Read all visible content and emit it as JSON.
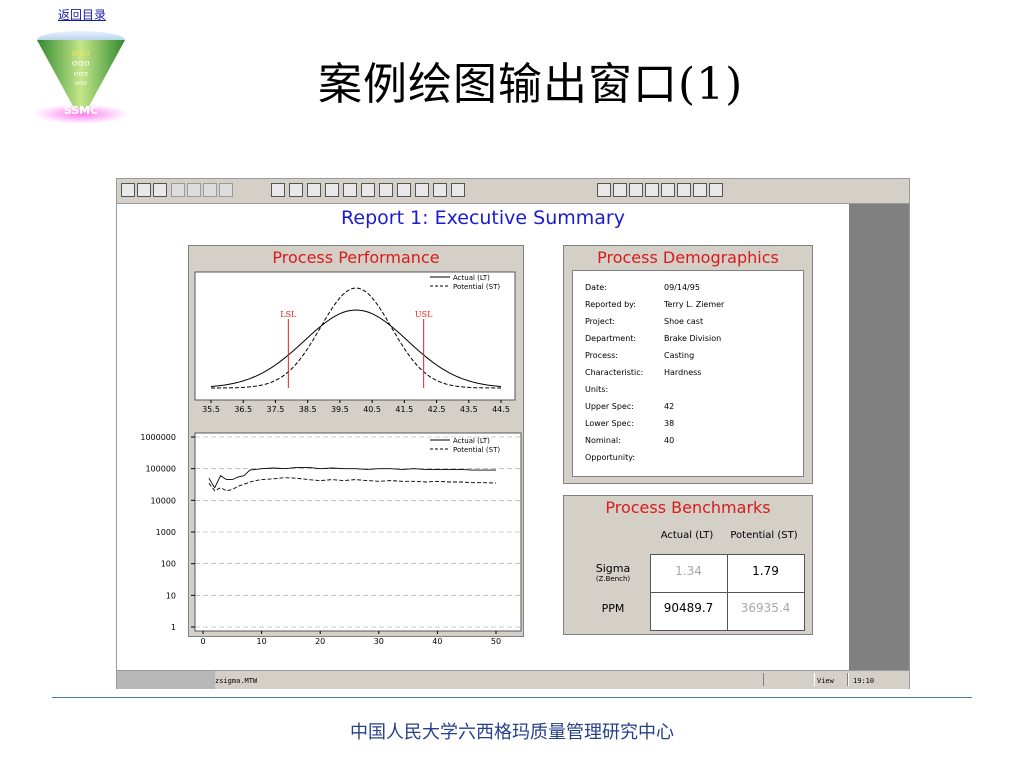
{
  "nav": {
    "back_label": "返回目录"
  },
  "logo": {
    "symbol_rows": [
      "σσσ",
      "σσσ",
      "σσσ",
      "σσσ"
    ],
    "text": "SSMC"
  },
  "slide": {
    "title": "案例绘图输出窗口(1)"
  },
  "footer": {
    "text": "中国人民大学六西格玛质量管理研究中心"
  },
  "window": {
    "status": {
      "file": "zsigma.MTW",
      "mode": "View",
      "clock": "19:10"
    },
    "toolbar_icons": [
      "open-icon",
      "save-icon",
      "print-icon",
      "cut-icon",
      "copy-icon",
      "paste-icon",
      "undo-icon",
      "session-window-icon",
      "data-window-icon",
      "info-icon",
      "history-icon",
      "graph-icon",
      "brush-icon",
      "edit-graph-icon",
      "pen-icon",
      "cancel-icon",
      "help-icon",
      "project-manager-icon",
      "graph-folder-icon",
      "show-graphs-icon",
      "tile-icon",
      "info2-icon",
      "report-pad-icon",
      "related-docs-icon",
      "new-graph-icon",
      "layout-icon"
    ]
  },
  "report": {
    "title": "Report 1: Executive Summary",
    "performance": {
      "title": "Process Performance"
    },
    "demographics": {
      "title": "Process Demographics",
      "rows": [
        {
          "label": "Date:",
          "value": "09/14/95"
        },
        {
          "label": "Reported by:",
          "value": "Terry L. Ziemer"
        },
        {
          "label": "Project:",
          "value": "Shoe cast"
        },
        {
          "label": "Department:",
          "value": "Brake Division"
        },
        {
          "label": "Process:",
          "value": "Casting"
        },
        {
          "label": "Characteristic:",
          "value": "Hardness"
        },
        {
          "label": "Units:",
          "value": ""
        },
        {
          "label": "Upper Spec:",
          "value": "42"
        },
        {
          "label": "Lower Spec:",
          "value": "38"
        },
        {
          "label": "Nominal:",
          "value": "40"
        },
        {
          "label": "Opportunity:",
          "value": ""
        }
      ]
    },
    "benchmarks": {
      "title": "Process Benchmarks",
      "col_actual": "Actual (LT)",
      "col_potential": "Potential (ST)",
      "sigma_label": "Sigma",
      "sigma_sub": "(Z.Bench)",
      "ppm_label": "PPM",
      "sigma_actual": "1.34",
      "sigma_potential": "1.79",
      "ppm_actual": "90489.7",
      "ppm_potential": "36935.4"
    }
  },
  "chart_data": [
    {
      "type": "line",
      "xlim": [
        35.5,
        44.5
      ],
      "x_ticks": [
        "35.5",
        "36.5",
        "37.5",
        "38.5",
        "39.5",
        "40.5",
        "41.5",
        "42.5",
        "43.5",
        "44.5"
      ],
      "series": [
        {
          "name": "Actual (LT)",
          "style": "solid",
          "mean": 40,
          "sd": 1.6,
          "peak": 0.78
        },
        {
          "name": "Potential (ST)",
          "style": "dashed",
          "mean": 40,
          "sd": 1.1,
          "peak": 1.0
        }
      ],
      "spec_lines": [
        {
          "label": "LSL",
          "x": 37.9,
          "color": "#e02020"
        },
        {
          "label": "USL",
          "x": 42.1,
          "color": "#e02020"
        }
      ],
      "legend": "top-right"
    },
    {
      "type": "line",
      "y_scale": "log",
      "ylim": [
        1,
        1000000
      ],
      "y_ticks": [
        "1000000",
        "100000",
        "10000",
        "1000",
        "100",
        "10",
        "1"
      ],
      "xlim": [
        0,
        50
      ],
      "x_ticks": [
        "0",
        "10",
        "20",
        "30",
        "40",
        "50"
      ],
      "grid": true,
      "series": [
        {
          "name": "Actual (LT)",
          "style": "solid",
          "x": [
            1,
            2,
            3,
            4,
            5,
            6,
            7,
            8,
            9,
            10,
            12,
            14,
            16,
            18,
            20,
            22,
            24,
            26,
            28,
            30,
            32,
            34,
            36,
            38,
            40,
            42,
            44,
            46,
            48,
            50
          ],
          "values": [
            50000,
            25000,
            60000,
            45000,
            45000,
            55000,
            60000,
            90000,
            95000,
            100000,
            105000,
            100000,
            110000,
            110000,
            100000,
            105000,
            100000,
            100000,
            95000,
            100000,
            100000,
            95000,
            100000,
            95000,
            95000,
            95000,
            95000,
            90000,
            90000,
            90000
          ]
        },
        {
          "name": "Potential (ST)",
          "style": "dashed",
          "x": [
            1,
            2,
            3,
            4,
            5,
            6,
            7,
            8,
            9,
            10,
            12,
            14,
            16,
            18,
            20,
            22,
            24,
            26,
            28,
            30,
            32,
            34,
            36,
            38,
            40,
            42,
            44,
            46,
            48,
            50
          ],
          "values": [
            35000,
            20000,
            25000,
            20000,
            22000,
            28000,
            32000,
            38000,
            42000,
            45000,
            48000,
            52000,
            50000,
            45000,
            42000,
            45000,
            42000,
            45000,
            42000,
            40000,
            42000,
            40000,
            40000,
            38000,
            40000,
            38000,
            38000,
            36000,
            36000,
            35000
          ]
        }
      ],
      "legend": "top-right"
    }
  ]
}
